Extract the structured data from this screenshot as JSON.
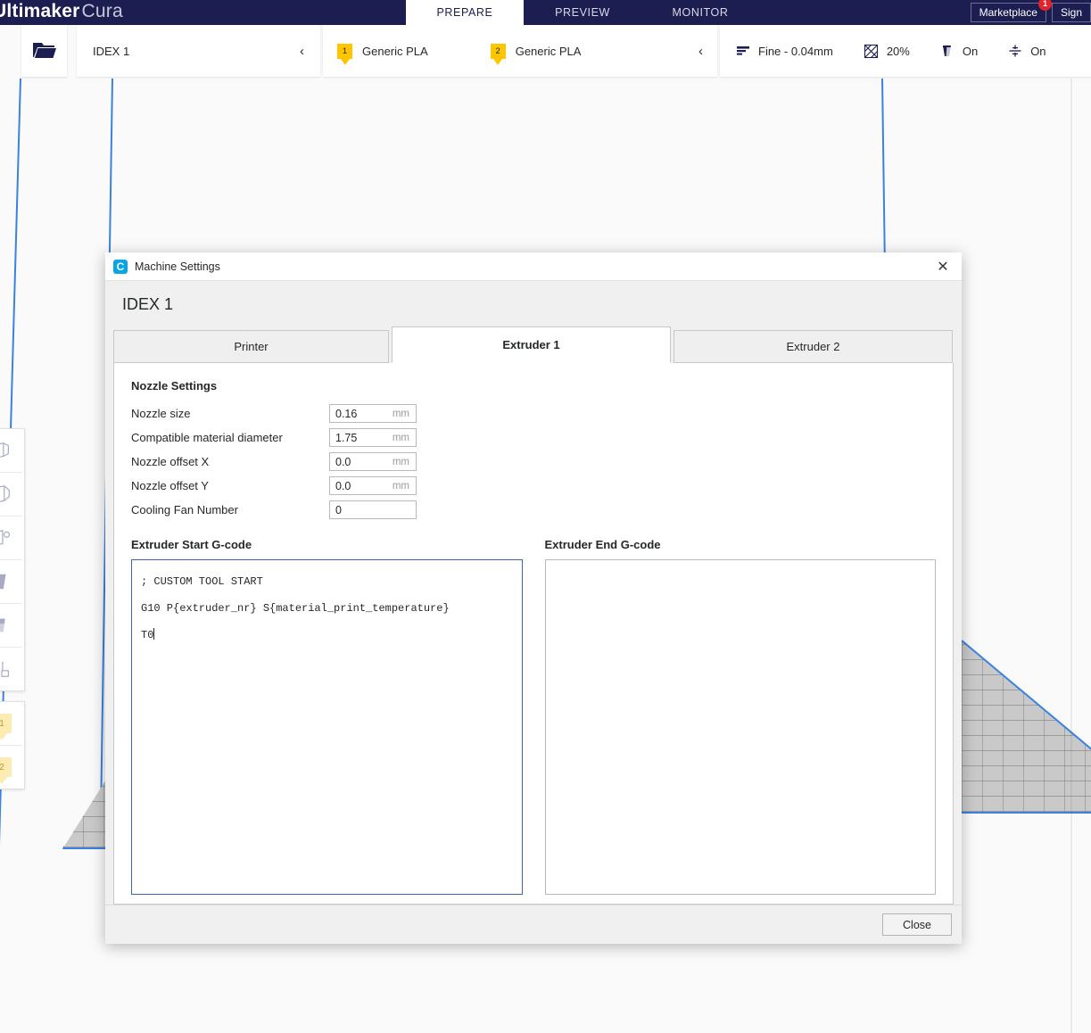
{
  "app": {
    "brand_bold": "Ultimaker",
    "brand_light": "Cura",
    "stages": [
      {
        "label": "PREPARE",
        "active": true
      },
      {
        "label": "PREVIEW",
        "active": false
      },
      {
        "label": "MONITOR",
        "active": false
      }
    ],
    "marketplace_label": "Marketplace",
    "marketplace_badge": "1",
    "signin_label": "Sign"
  },
  "configbar": {
    "open_file_icon": "open-folder-icon",
    "printer": {
      "name": "IDEX 1",
      "chevron": "‹"
    },
    "materials": [
      {
        "index": "1",
        "name": "Generic PLA"
      },
      {
        "index": "2",
        "name": "Generic PLA"
      }
    ],
    "materials_chevron": "‹",
    "profile": {
      "quality_icon": "layer-height-icon",
      "quality": "Fine - 0.04mm",
      "infill_icon": "infill-icon",
      "infill": "20%",
      "support_icon": "support-icon",
      "support": "On",
      "adhesion_icon": "adhesion-icon",
      "adhesion": "On",
      "edit_icon": "pencil-icon"
    }
  },
  "toolbar": {
    "tools": [
      {
        "icon": "move-tool-icon"
      },
      {
        "icon": "scale-tool-icon"
      },
      {
        "icon": "rotate-tool-icon"
      },
      {
        "icon": "mirror-tool-icon"
      },
      {
        "icon": "per-model-settings-icon"
      },
      {
        "icon": "support-blocker-icon"
      }
    ],
    "extruder_buttons": [
      {
        "index": "1"
      },
      {
        "index": "2"
      }
    ]
  },
  "dialog": {
    "titlebar": {
      "logo": "cura-logo-icon",
      "logo_letter": "C",
      "title": "Machine Settings",
      "close_icon": "✕"
    },
    "heading": "IDEX 1",
    "tabs": [
      {
        "label": "Printer",
        "active": false
      },
      {
        "label": "Extruder 1",
        "active": true
      },
      {
        "label": "Extruder 2",
        "active": false
      }
    ],
    "nozzle_section_title": "Nozzle Settings",
    "nozzle_rows": [
      {
        "label": "Nozzle size",
        "value": "0.16",
        "unit": "mm"
      },
      {
        "label": "Compatible material diameter",
        "value": "1.75",
        "unit": "mm"
      },
      {
        "label": "Nozzle offset X",
        "value": "0.0",
        "unit": "mm"
      },
      {
        "label": "Nozzle offset Y",
        "value": "0.0",
        "unit": "mm"
      },
      {
        "label": "Cooling Fan Number",
        "value": "0",
        "unit": ""
      }
    ],
    "start_gcode": {
      "title": "Extruder Start G-code",
      "value": "; CUSTOM TOOL START\nG10 P{extruder_nr} S{material_print_temperature}\nT0",
      "focused": true
    },
    "end_gcode": {
      "title": "Extruder End G-code",
      "value": "",
      "focused": false
    },
    "close_button": "Close"
  },
  "colors": {
    "appbar_bg": "#1c1d51",
    "accent_yellow": "#ffc600",
    "cura_blue": "#09a6e7",
    "plate_outline": "#3b82e0",
    "badge_red": "#e5232b",
    "focus_border": "#3b63b5"
  }
}
